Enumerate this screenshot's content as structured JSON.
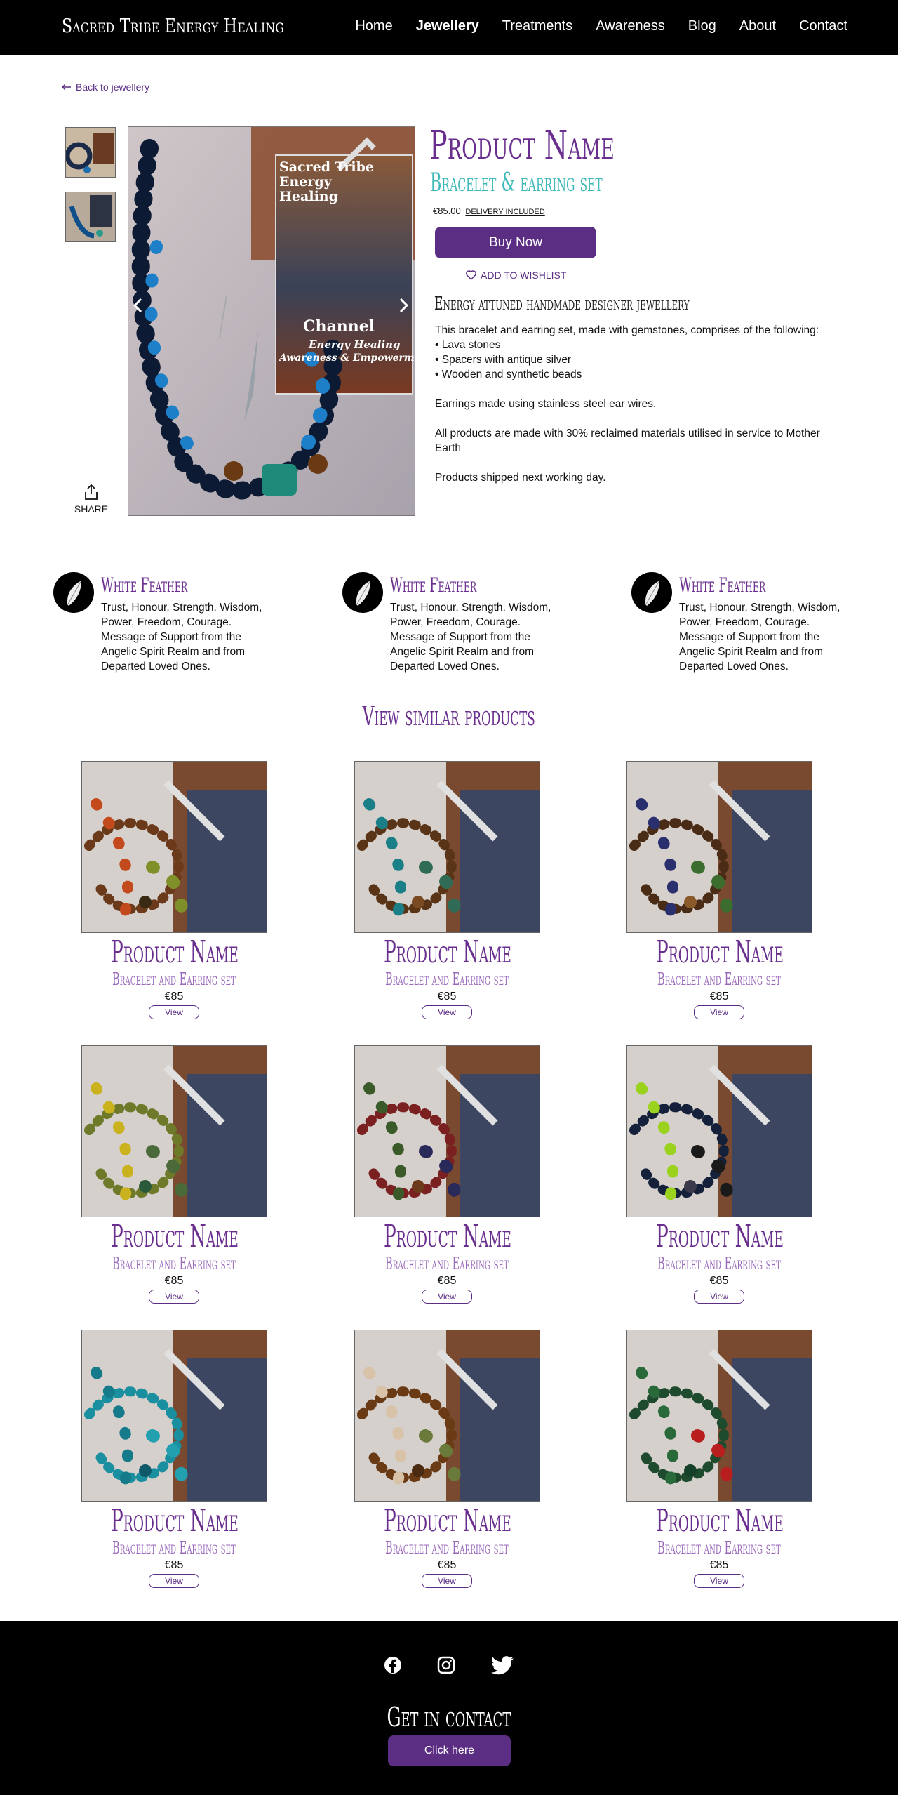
{
  "header": {
    "logo": "Sacred Tribe Energy Healing",
    "nav": [
      "Home",
      "Jewellery",
      "Treatments",
      "Awareness",
      "Blog",
      "About",
      "Contact"
    ],
    "active_nav": "Jewellery"
  },
  "product": {
    "back_label": "Back to jewellery",
    "name": "Product Name",
    "subtitle": "Bracelet & earring set",
    "price": "€85.00",
    "delivery": "DELIVERY INCLUDED",
    "buy_label": "Buy Now",
    "wishlist_label": "ADD TO WISHLIST",
    "share_label": "SHARE",
    "image_card_lines": [
      "Sacred Tribe",
      "Energy",
      "Healing",
      "Channel",
      "Energy Healing",
      "Awareness & Empowerment"
    ],
    "description_title": "Energy attuned handmade designer jewellery",
    "description": [
      "This bracelet and earring set, made with gemstones, comprises of the following:",
      "• Lava stones",
      "• Spacers with antique silver",
      "• Wooden and synthetic beads",
      "Earrings made using stainless steel ear wires.",
      "All products are made with 30% reclaimed materials utilised in service to Mother Earth",
      "Products shipped next working day."
    ]
  },
  "feathers": [
    {
      "title": "White Feather",
      "text": "Trust, Honour, Strength, Wisdom, Power, Freedom, Courage. Message of Support from the Angelic Spirit Realm and from Departed Loved Ones."
    },
    {
      "title": "White Feather",
      "text": "Trust, Honour, Strength, Wisdom, Power, Freedom, Courage. Message of Support from the Angelic Spirit Realm and from Departed Loved Ones."
    },
    {
      "title": "White Feather",
      "text": "Trust, Honour, Strength, Wisdom, Power, Freedom, Courage. Message of Support from the Angelic Spirit Realm and from Departed Loved Ones."
    }
  ],
  "similar": {
    "title": "View similar products",
    "items": [
      {
        "name": "Product Name",
        "subtitle": "Bracelet and Earring set",
        "price": "€85",
        "view": "View",
        "bead_colors": [
          "#6b3a1a",
          "#c24a1c",
          "#7f8f2a",
          "#3a2a14"
        ]
      },
      {
        "name": "Product Name",
        "subtitle": "Bracelet and Earring set",
        "price": "€85",
        "view": "View",
        "bead_colors": [
          "#5a3416",
          "#1a7f86",
          "#2f6b55",
          "#7a4a22"
        ]
      },
      {
        "name": "Product Name",
        "subtitle": "Bracelet and Earring set",
        "price": "€85",
        "view": "View",
        "bead_colors": [
          "#4a2c16",
          "#2a2f6e",
          "#3b6e2e",
          "#8a5a2a"
        ]
      },
      {
        "name": "Product Name",
        "subtitle": "Bracelet and Earring set",
        "price": "€85",
        "view": "View",
        "bead_colors": [
          "#6e7a2a",
          "#c9b21e",
          "#4a6a3a",
          "#2a5a3a"
        ]
      },
      {
        "name": "Product Name",
        "subtitle": "Bracelet and Earring set",
        "price": "€85",
        "view": "View",
        "bead_colors": [
          "#7a2020",
          "#3a5a2a",
          "#2a2a5a",
          "#6a3a1a"
        ]
      },
      {
        "name": "Product Name",
        "subtitle": "Bracelet and Earring set",
        "price": "€85",
        "view": "View",
        "bead_colors": [
          "#15203a",
          "#9ad21e",
          "#1a1a1a",
          "#3a3a4a"
        ]
      },
      {
        "name": "Product Name",
        "subtitle": "Bracelet and Earring set",
        "price": "€85",
        "view": "View",
        "bead_colors": [
          "#1a8fa0",
          "#157a8a",
          "#22a0b0",
          "#0e5a6a"
        ]
      },
      {
        "name": "Product Name",
        "subtitle": "Bracelet and Earring set",
        "price": "€85",
        "view": "View",
        "bead_colors": [
          "#6a3a14",
          "#d8c2a8",
          "#6a7a3a",
          "#4a2a10"
        ]
      },
      {
        "name": "Product Name",
        "subtitle": "Bracelet and Earring set",
        "price": "€85",
        "view": "View",
        "bead_colors": [
          "#1e4a2e",
          "#2a6a3a",
          "#b81e1e",
          "#15402a"
        ]
      }
    ]
  },
  "footer": {
    "socials": [
      "facebook-icon",
      "instagram-icon",
      "twitter-icon"
    ],
    "contact_title": "Get in contact",
    "click_label": "Click here"
  },
  "colors": {
    "brand_purple": "#5b2e84",
    "title_purple": "#6a2f8e",
    "teal": "#3fb9b7",
    "header_bg": "#000000"
  }
}
